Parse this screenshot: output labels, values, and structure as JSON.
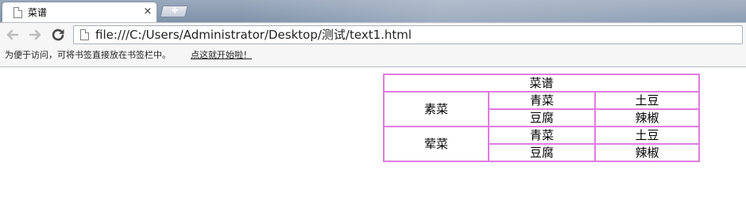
{
  "browser": {
    "tab": {
      "title": "菜谱",
      "close": "×"
    },
    "new_tab": "+",
    "toolbar": {
      "back_icon": "arrow-left-icon",
      "forward_icon": "arrow-right-icon",
      "reload_icon": "reload-icon",
      "url": "file:///C:/Users/Administrator/Desktop/测试/text1.html"
    },
    "bookmarks": {
      "hint": "为便于访问，可将书签直接放在书签栏中。",
      "link": "点这就开始啦！"
    }
  },
  "page": {
    "table": {
      "caption": "菜谱",
      "groups": [
        {
          "name": "素菜",
          "rows": [
            [
              "青菜",
              "土豆"
            ],
            [
              "豆腐",
              "辣椒"
            ]
          ]
        },
        {
          "name": "荤菜",
          "rows": [
            [
              "青菜",
              "土豆"
            ],
            [
              "豆腐",
              "辣椒"
            ]
          ]
        }
      ]
    }
  },
  "colors": {
    "table_border": "#e07be0",
    "tab_bg": "#ffffff",
    "chrome_bg": "#f6f6f6"
  }
}
